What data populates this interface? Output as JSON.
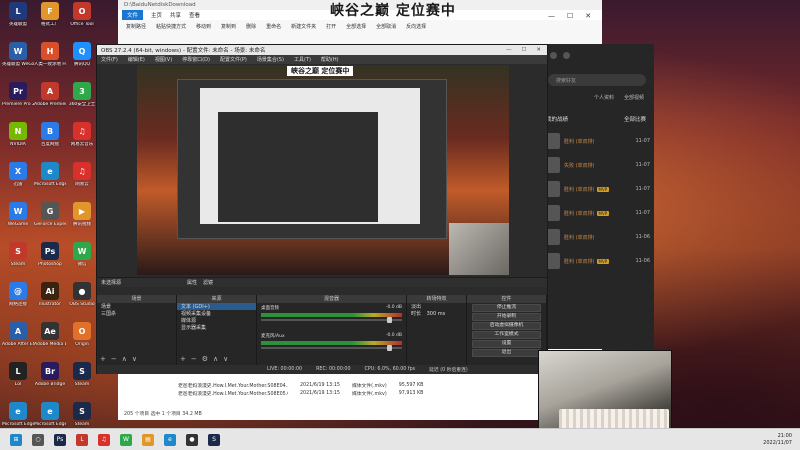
{
  "overlay_title": "峡谷之巅 定位赛中",
  "desktop_icons": [
    {
      "label": "英雄联盟",
      "color": "#1f3a7a",
      "glyph": "L"
    },
    {
      "label": "格式工厂",
      "color": "#e0962a",
      "glyph": "F"
    },
    {
      "label": "Office Tool",
      "color": "#c0392b",
      "glyph": "O"
    },
    {
      "label": "英雄联盟 WeGame版",
      "color": "#2a5ea8",
      "glyph": "W"
    },
    {
      "label": "人类一败涂地 Human Fall Flat",
      "color": "#d94f2a",
      "glyph": "H"
    },
    {
      "label": "腾讯QQ",
      "color": "#1e90ff",
      "glyph": "Q"
    },
    {
      "label": "Premiere Pro 2019",
      "color": "#2a1b5c",
      "glyph": "Pr"
    },
    {
      "label": "Adobe Premiere",
      "color": "#c0392b",
      "glyph": "A"
    },
    {
      "label": "360安全卫士",
      "color": "#2ea84a",
      "glyph": "3"
    },
    {
      "label": "NVIDIA",
      "color": "#76b900",
      "glyph": "N"
    },
    {
      "label": "百度网盘",
      "color": "#2a7be8",
      "glyph": "B"
    },
    {
      "label": "网易云音乐",
      "color": "#d8302a",
      "glyph": "♫"
    },
    {
      "label": "迅雷",
      "color": "#2a7be8",
      "glyph": "X"
    },
    {
      "label": "Microsoft Edge",
      "color": "#1e88c8",
      "glyph": "e"
    },
    {
      "label": "网易云",
      "color": "#d8302a",
      "glyph": "♫"
    },
    {
      "label": "WeGame",
      "color": "#2a7be8",
      "glyph": "W"
    },
    {
      "label": "GeForce Experience",
      "color": "#555",
      "glyph": "G"
    },
    {
      "label": "腾讯视频",
      "color": "#e0962a",
      "glyph": "▶"
    },
    {
      "label": "Steam",
      "color": "#c0392b",
      "glyph": "S"
    },
    {
      "label": "Photoshop",
      "color": "#1b2a4a",
      "glyph": "Ps"
    },
    {
      "label": "微信",
      "color": "#2ea84a",
      "glyph": "W"
    },
    {
      "label": "网络连接",
      "color": "#2a7be8",
      "glyph": "@"
    },
    {
      "label": "Illustrator",
      "color": "#3a2410",
      "glyph": "Ai"
    },
    {
      "label": "OBS Studio",
      "color": "#333",
      "glyph": "●"
    },
    {
      "label": "Adobe After Effects",
      "color": "#2a5ea8",
      "glyph": "A"
    },
    {
      "label": "Adobe Media Encoder",
      "color": "#333",
      "glyph": "Ae"
    },
    {
      "label": "Origin",
      "color": "#e0702a",
      "glyph": "O"
    },
    {
      "label": "Lol",
      "color": "#222",
      "glyph": "L"
    },
    {
      "label": "Adobe Bridge",
      "color": "#2a1b5c",
      "glyph": "Br"
    },
    {
      "label": "Steam",
      "color": "#1b2a4a",
      "glyph": "S"
    },
    {
      "label": "Microsoft Edge",
      "color": "#1e88c8",
      "glyph": "e"
    },
    {
      "label": "Microsoft Edge",
      "color": "#1e88c8",
      "glyph": "e"
    },
    {
      "label": "Steam",
      "color": "#1b2a4a",
      "glyph": "S"
    }
  ],
  "explorer": {
    "path": "D:\\BaiduNetdiskDownload",
    "tabs": [
      "文件",
      "主页",
      "共享",
      "查看"
    ],
    "ribbon": [
      "复制路径",
      "粘贴快捷方式",
      "移动到",
      "复制到",
      "删除",
      "重命名",
      "新建文件夹",
      "打开",
      "全部选择",
      "全部取消",
      "反向选择"
    ],
    "files": [
      {
        "name": "老爸老妈浪漫史.How.I.Met.Your.Mother.S08E04...",
        "date": "2021/6/19 13:15",
        "type": "媒体文件(.mkv)",
        "size": "95,597 KB"
      },
      {
        "name": "老爸老妈浪漫史.How.I.Met.Your.Mother.S08E05.Chi_Eng.WEBrip...",
        "date": "2021/6/19 13:15",
        "type": "媒体文件(.mkv)",
        "size": "97,913 KB"
      }
    ],
    "status": "205 个项目    选中 1 个项目  34.2 MB"
  },
  "side_panel": {
    "search_placeholder": "搜索好友",
    "tabs": [
      "个人资料",
      "全部视频"
    ],
    "heading": "我的战绩",
    "heading_right": "全部比赛",
    "rows": [
      {
        "name": "胜利 (单双排)",
        "time": "11-07",
        "badge": ""
      },
      {
        "name": "失败 (单双排)",
        "time": "11-07",
        "badge": ""
      },
      {
        "name": "胜利 (单双排)",
        "time": "11-07",
        "badge": "MVP"
      },
      {
        "name": "胜利 (单双排)",
        "time": "11-07",
        "badge": "MVP"
      },
      {
        "name": "胜利 (单双排)",
        "time": "11-06",
        "badge": ""
      },
      {
        "name": "胜利 (单双排)",
        "time": "11-06",
        "badge": "MVP"
      }
    ]
  },
  "obs": {
    "title": "OBS 27.2.4 (64-bit, windows) - 配置文件: 未命名 - 场景: 未命名",
    "menu": [
      "文件(F)",
      "编辑(E)",
      "视图(V)",
      "停靠窗口(D)",
      "配置文件(P)",
      "场景集合(S)",
      "工具(T)",
      "帮助(H)"
    ],
    "nested_title": "峡谷之巅 定位赛中",
    "controls_bar": [
      "未选择源",
      "属性",
      "滤镜"
    ],
    "docks": {
      "scenes": {
        "header": "场景",
        "items": [
          "场景",
          "三国杀"
        ]
      },
      "sources": {
        "header": "来源",
        "items": [
          "文本 (GDI+)",
          "视频采集设备",
          "媒体源",
          "显示器采集"
        ]
      },
      "mixer": {
        "header": "混音器",
        "channels": [
          {
            "name": "桌面音频",
            "level": "-0.0 dB"
          },
          {
            "name": "麦克风/Aux",
            "level": "-0.0 dB"
          }
        ]
      },
      "transitions": {
        "header": "转场特效",
        "type": "淡出",
        "duration_label": "时长",
        "duration": "300 ms"
      },
      "controls": {
        "header": "控件",
        "buttons": [
          "停止推流",
          "开始录制",
          "启动虚拟摄像机",
          "工作室模式",
          "设置",
          "退出"
        ]
      }
    },
    "status": {
      "live": "LIVE: 00:00:00",
      "rec": "REC: 00:00:00",
      "cpu": "CPU: 6.0%, 60.00 fps",
      "drop": "延迟 (0 秒后重连)"
    }
  },
  "taskbar": {
    "clock_time": "21:00",
    "clock_date": "2022/11/07",
    "icons": [
      {
        "name": "start",
        "color": "#1e88c8",
        "glyph": "⊞"
      },
      {
        "name": "search",
        "color": "#555",
        "glyph": "○"
      },
      {
        "name": "photoshop",
        "color": "#1b2a4a",
        "glyph": "Ps"
      },
      {
        "name": "lol",
        "color": "#c0392b",
        "glyph": "L"
      },
      {
        "name": "netease",
        "color": "#d8302a",
        "glyph": "♫"
      },
      {
        "name": "wechat",
        "color": "#2ea84a",
        "glyph": "W"
      },
      {
        "name": "explorer",
        "color": "#e0962a",
        "glyph": "▤"
      },
      {
        "name": "edge",
        "color": "#1e88c8",
        "glyph": "e"
      },
      {
        "name": "obs",
        "color": "#333",
        "glyph": "●"
      },
      {
        "name": "steam",
        "color": "#1b2a4a",
        "glyph": "S"
      }
    ]
  }
}
